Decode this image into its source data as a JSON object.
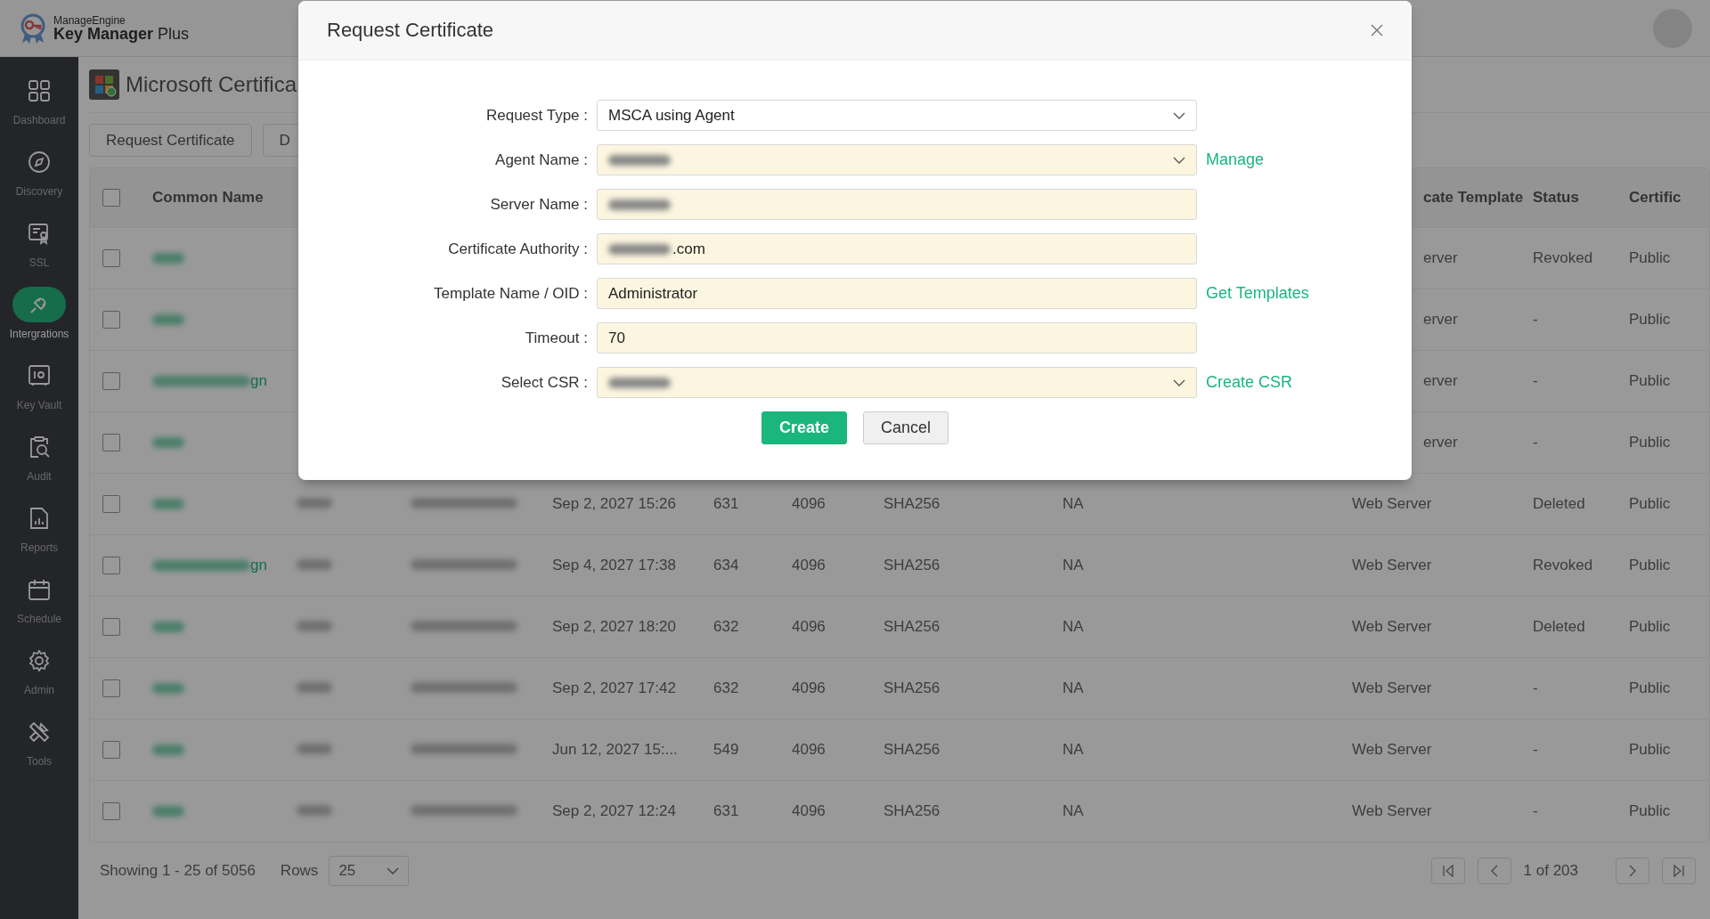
{
  "app": {
    "vendor": "ManageEngine",
    "product": "**Key Manager** Plus"
  },
  "sidebar": {
    "items": [
      {
        "label": "Dashboard",
        "selected": false
      },
      {
        "label": "Discovery",
        "selected": false
      },
      {
        "label": "SSL",
        "selected": false
      },
      {
        "label": "Intergrations",
        "selected": true
      },
      {
        "label": "Key Vault",
        "selected": false
      },
      {
        "label": "Audit",
        "selected": false
      },
      {
        "label": "Reports",
        "selected": false
      },
      {
        "label": "Schedule",
        "selected": false
      },
      {
        "label": "Admin",
        "selected": false
      },
      {
        "label": "Tools",
        "selected": false
      }
    ]
  },
  "page": {
    "title": "Microsoft Certifica",
    "actions": [
      "Request Certificate",
      "D"
    ]
  },
  "table": {
    "header_covered": true,
    "all_checked": false,
    "columns": [
      "Common Name",
      "cate Template",
      "Status",
      "Certific"
    ],
    "rows": [
      {
        "covered": true,
        "checked": false,
        "template": "erver",
        "status": "Revoked",
        "type": "Public"
      },
      {
        "covered": true,
        "checked": false,
        "template": "erver",
        "status": "-",
        "type": "Public"
      },
      {
        "covered": true,
        "checked": false,
        "name_tail": "gn",
        "template": "erver",
        "status": "-",
        "type": "Public"
      },
      {
        "covered": true,
        "checked": false,
        "template": "erver",
        "status": "-",
        "type": "Public"
      },
      {
        "covered": false,
        "checked": false,
        "date": "Sep 2, 2027 15:26",
        "column_5": "631",
        "column_6": "4096",
        "column_7": "SHA256",
        "column_8": "NA",
        "template": "Web Server",
        "status": "Deleted",
        "type": "Public"
      },
      {
        "covered": false,
        "checked": false,
        "name_tail": "gn",
        "date": "Sep 4, 2027 17:38",
        "column_5": "634",
        "column_6": "4096",
        "column_7": "SHA256",
        "column_8": "NA",
        "template": "Web Server",
        "status": "Revoked",
        "type": "Public"
      },
      {
        "covered": false,
        "checked": false,
        "date": "Sep 2, 2027 18:20",
        "column_5": "632",
        "column_6": "4096",
        "column_7": "SHA256",
        "column_8": "NA",
        "template": "Web Server",
        "status": "Deleted",
        "type": "Public"
      },
      {
        "covered": false,
        "checked": false,
        "date": "Sep 2, 2027 17:42",
        "column_5": "632",
        "column_6": "4096",
        "column_7": "SHA256",
        "column_8": "NA",
        "template": "Web Server",
        "status": "-",
        "type": "Public"
      },
      {
        "covered": false,
        "checked": false,
        "date": "Jun 12, 2027 15:...",
        "column_5": "549",
        "column_6": "4096",
        "column_7": "SHA256",
        "column_8": "NA",
        "template": "Web Server",
        "status": "-",
        "type": "Public"
      },
      {
        "covered": false,
        "checked": false,
        "date": "Sep 2, 2027 12:24",
        "column_5": "631",
        "column_6": "4096",
        "column_7": "SHA256",
        "column_8": "NA",
        "template": "Web Server",
        "status": "-",
        "type": "Public"
      }
    ]
  },
  "footer": {
    "showing": "Showing 1 - 25 of 5056",
    "rows_label": "Rows",
    "rows_value": "25",
    "page": "1 of 203"
  },
  "dialog": {
    "title": "Request Certificate",
    "fields": [
      {
        "label": "Request Type :",
        "kind": "select",
        "value": "MSCA using Agent",
        "redacted": false,
        "autofilled": false
      },
      {
        "label": "Agent Name :",
        "kind": "select",
        "redacted": true,
        "autofilled": true,
        "link": "Manage"
      },
      {
        "label": "Server Name :",
        "kind": "input",
        "redacted": true,
        "autofilled": true
      },
      {
        "label": "Certificate Authority :",
        "kind": "input",
        "value": ".com",
        "redacted": true,
        "autofilled": true
      },
      {
        "label": "Template Name / OID :",
        "kind": "input",
        "value": "Administrator",
        "redacted": false,
        "autofilled": true,
        "link": "Get Templates"
      },
      {
        "label": "Timeout :",
        "kind": "input",
        "value": "70",
        "redacted": false,
        "autofilled": true
      },
      {
        "label": "Select CSR :",
        "kind": "select",
        "redacted": true,
        "autofilled": true,
        "link": "Create CSR"
      }
    ],
    "buttons": [
      {
        "label": "Create",
        "primary": true
      },
      {
        "label": "Cancel",
        "primary": false
      }
    ]
  }
}
